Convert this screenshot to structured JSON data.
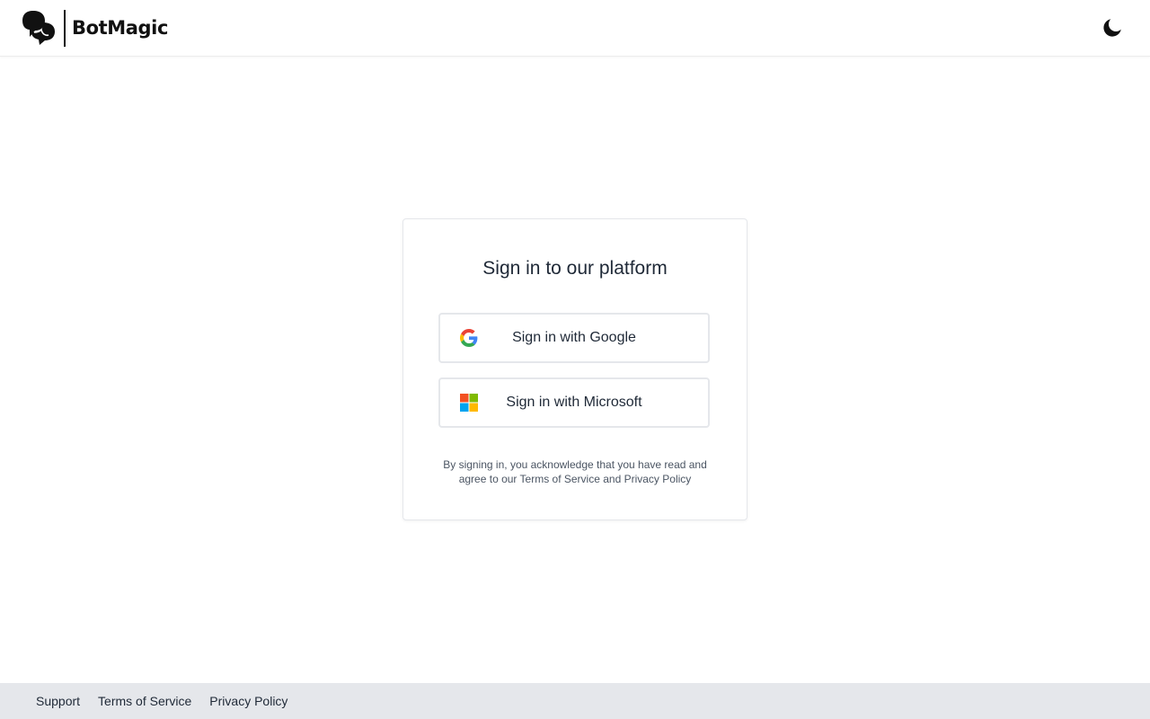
{
  "header": {
    "brand_name": "BotMagic",
    "logo_icon": "chat-bubbles-icon",
    "theme_toggle_icon": "moon-icon"
  },
  "signin": {
    "title": "Sign in to our platform",
    "google_label": "Sign in with Google",
    "microsoft_label": "Sign in with Microsoft",
    "legal_prefix": "By signing in, you acknowledge that you have read and agree to our ",
    "legal_terms": "Terms of Service",
    "legal_and": " and ",
    "legal_privacy": "Privacy Policy"
  },
  "footer": {
    "links": [
      "Support",
      "Terms of Service",
      "Privacy Policy"
    ]
  },
  "colors": {
    "google_blue": "#4285F4",
    "google_red": "#EA4335",
    "google_yellow": "#FBBC05",
    "google_green": "#34A853",
    "ms_red": "#F25022",
    "ms_green": "#7FBA00",
    "ms_blue": "#00A4EF",
    "ms_yellow": "#FFB900",
    "footer_bg": "#e5e7eb"
  }
}
